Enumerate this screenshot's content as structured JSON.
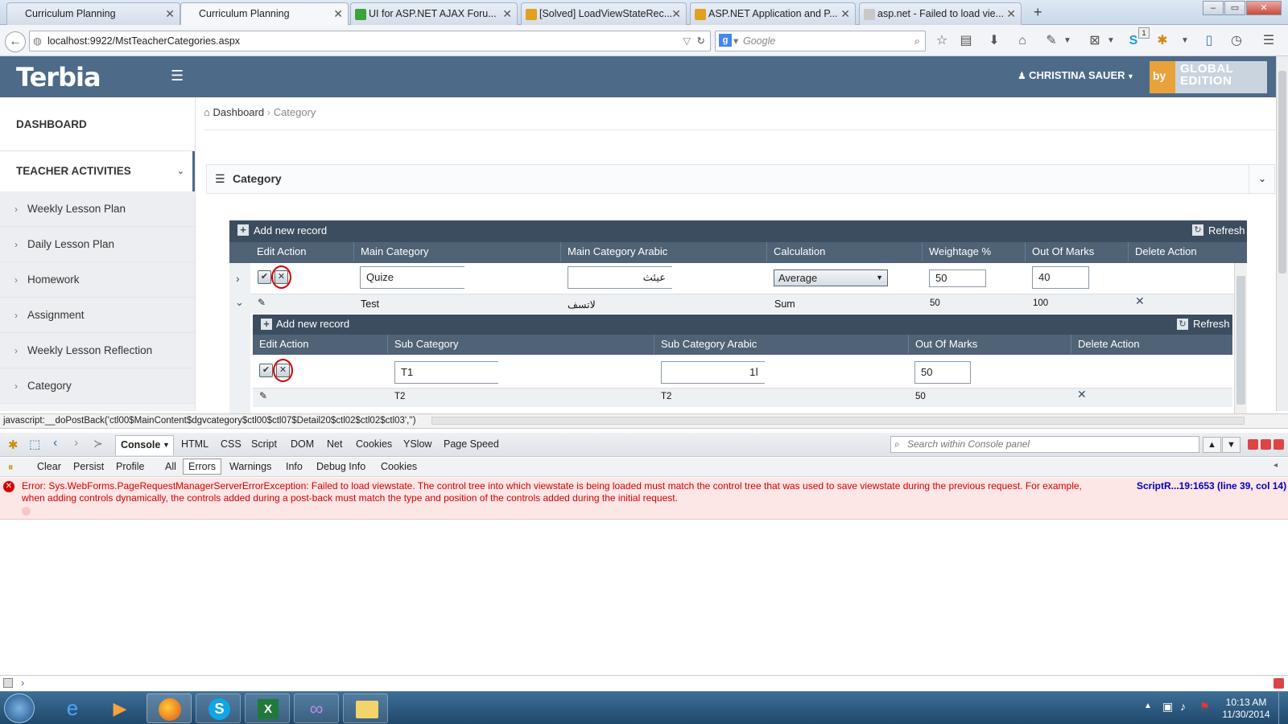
{
  "browser": {
    "tabs": [
      {
        "title": "Curriculum Planning",
        "active": false
      },
      {
        "title": "Curriculum Planning",
        "active": true
      },
      {
        "title": "UI for ASP.NET AJAX Foru...",
        "active": false
      },
      {
        "title": "[Solved] LoadViewStateRec...",
        "active": false
      },
      {
        "title": "ASP.NET Application and P...",
        "active": false
      },
      {
        "title": "asp.net - Failed to load vie...",
        "active": false
      }
    ],
    "new_tab": "+",
    "url": "localhost:9922/MstTeacherCategories.aspx",
    "search_placeholder": "Google",
    "notification_count": "1"
  },
  "app": {
    "logo": "Terbia",
    "user_name": "CHRISTINA SAUER",
    "badge_by": "by",
    "badge_line1": "GLOBAL",
    "badge_line2": "EDITION"
  },
  "sidebar": {
    "dashboard": "DASHBOARD",
    "section": "TEACHER ACTIVITIES",
    "items": [
      "Weekly Lesson Plan",
      "Daily Lesson Plan",
      "Homework",
      "Assignment",
      "Weekly Lesson Reflection",
      "Category"
    ]
  },
  "breadcrumb": {
    "home": "Dashboard",
    "current": "Category"
  },
  "panel": {
    "title": "Category"
  },
  "grid": {
    "add_label": "Add new record",
    "refresh_label": "Refresh",
    "columns": [
      "Edit Action",
      "Main Category",
      "Main Category Arabic",
      "Calculation",
      "Weightage %",
      "Out Of Marks",
      "Delete Action"
    ],
    "edit_row": {
      "main_category": "Quize",
      "main_category_arabic": "عيئث",
      "calculation": "Average",
      "weightage": "50",
      "out_of_marks": "40"
    },
    "data_row": {
      "main_category": "Test",
      "main_category_arabic": "لاتسف",
      "calculation": "Sum",
      "weightage": "50",
      "out_of_marks": "100"
    }
  },
  "subgrid": {
    "add_label": "Add new record",
    "refresh_label": "Refresh",
    "columns": [
      "Edit Action",
      "Sub Category",
      "Sub Category Arabic",
      "Out Of Marks",
      "Delete Action"
    ],
    "edit_row": {
      "sub_category": "T1",
      "sub_category_arabic": "ا1",
      "out_of_marks": "50"
    },
    "data_row": {
      "sub_category": "T2",
      "sub_category_arabic": "T2",
      "out_of_marks": "50"
    }
  },
  "statusbar": {
    "text": "javascript:__doPostBack('ctl00$MainContent$dgvcategory$ctl00$ctl07$Detail20$ctl02$ctl02$ctl03','')"
  },
  "firebug": {
    "tabs": [
      "Console",
      "HTML",
      "CSS",
      "Script",
      "DOM",
      "Net",
      "Cookies",
      "YSlow",
      "Page Speed"
    ],
    "search_placeholder": "Search within Console panel",
    "filters": [
      "Clear",
      "Persist",
      "Profile",
      "All",
      "Errors",
      "Warnings",
      "Info",
      "Debug Info",
      "Cookies"
    ],
    "error_line1": "Error: Sys.WebForms.PageRequestManagerServerErrorException: Failed to load viewstate.  The control tree into which viewstate is being loaded must match the control tree that was used to save viewstate during the previous request.  For example,",
    "error_line2": "when adding controls dynamically, the controls added during a post-back must match the type and position of the controls added during the initial request.",
    "error_source": "ScriptR...19:1653 (line 39, col 14)"
  },
  "taskbar": {
    "time": "10:13 AM",
    "date": "11/30/2014"
  },
  "colors": {
    "header": "#4d6a88",
    "grid_header": "#3c4d60",
    "error_text": "#d40000",
    "error_bg": "#fde6e6"
  }
}
